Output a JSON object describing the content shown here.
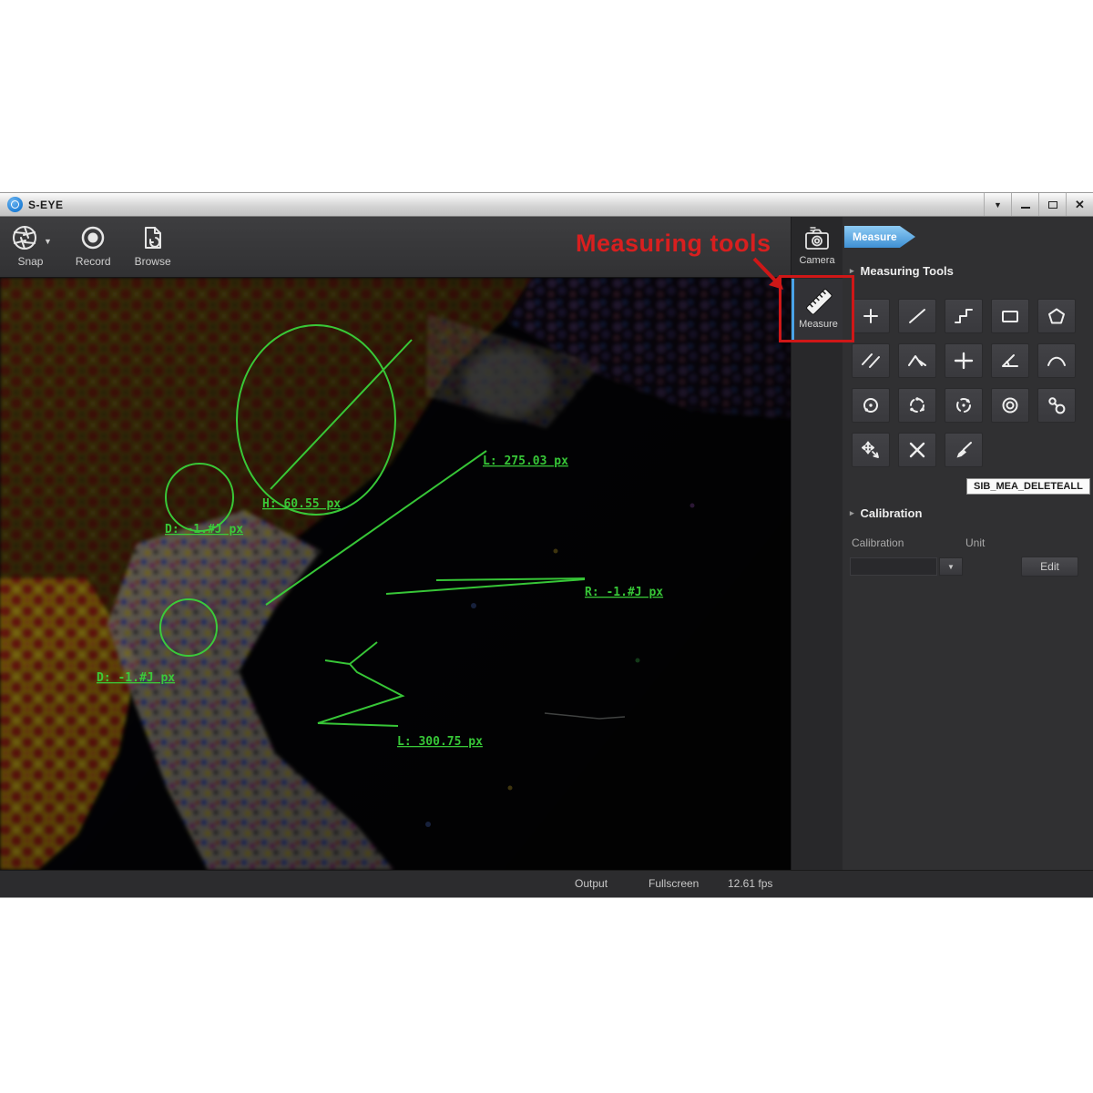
{
  "window": {
    "title": "S-EYE",
    "controls": [
      "pin-menu",
      "minimize",
      "maximize",
      "close"
    ]
  },
  "toolbar": {
    "snap": "Snap",
    "record": "Record",
    "browse": "Browse"
  },
  "side_tabs": {
    "camera": "Camera",
    "measure": "Measure"
  },
  "annotation": {
    "label": "Measuring tools",
    "color": "#d81f1f"
  },
  "panel": {
    "tag": "Measure",
    "measuring_tools_header": "Measuring Tools",
    "tooltip": "SIB_MEA_DELETEALL",
    "calibration_header": "Calibration",
    "calibration_label": "Calibration",
    "unit_label": "Unit",
    "edit_button": "Edit",
    "tools": [
      "point",
      "line",
      "polyline",
      "rectangle",
      "polygon",
      "parallel-lines",
      "perpendicular",
      "crosshair",
      "angle",
      "arc",
      "circle-center-radius",
      "circle-3-points",
      "circle-2-points",
      "concentric-circles",
      "two-circles",
      "move",
      "delete",
      "delete-all"
    ]
  },
  "statusbar": {
    "output": "Output",
    "fullscreen": "Fullscreen",
    "fps": "12.61 fps"
  },
  "measurements": {
    "h_label": "H: 60.55 px",
    "d1_label": "D: -1.#J px",
    "l1_label": "L: 275.03 px",
    "r_label": "R: -1.#J px",
    "d2_label": "D: -1.#J px",
    "l2_label": "L: 300.75 px"
  },
  "colors": {
    "accent_blue": "#4aa3e8",
    "annotation_red": "#d81f1f",
    "measure_green": "#3ad13a"
  }
}
